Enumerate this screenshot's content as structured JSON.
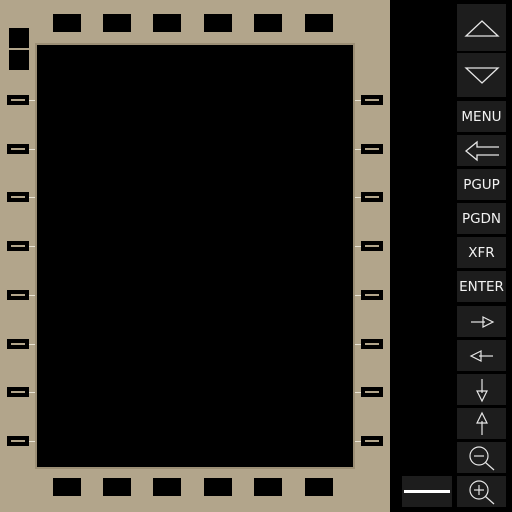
{
  "device": "mfd-control-display-unit",
  "colors": {
    "bezel": "#b2a58b",
    "screen": "#000000",
    "key_bg": "#1d1d1d",
    "key_text": "#f2f2f2"
  },
  "controls": {
    "scroll_up_icon": "triangle-up-icon",
    "scroll_down_icon": "triangle-down-icon",
    "menu": "MENU",
    "back_icon": "left-arrow-icon",
    "pgup": "PGUP",
    "pgdn": "PGDN",
    "xfr": "XFR",
    "enter": "ENTER",
    "right_icon": "arrow-right-icon",
    "left_icon": "arrow-left-icon",
    "down_icon": "arrow-down-icon",
    "up_icon": "arrow-up-icon",
    "zoom_out_icon": "zoom-out-icon",
    "zoom_in_icon": "zoom-in-icon"
  }
}
